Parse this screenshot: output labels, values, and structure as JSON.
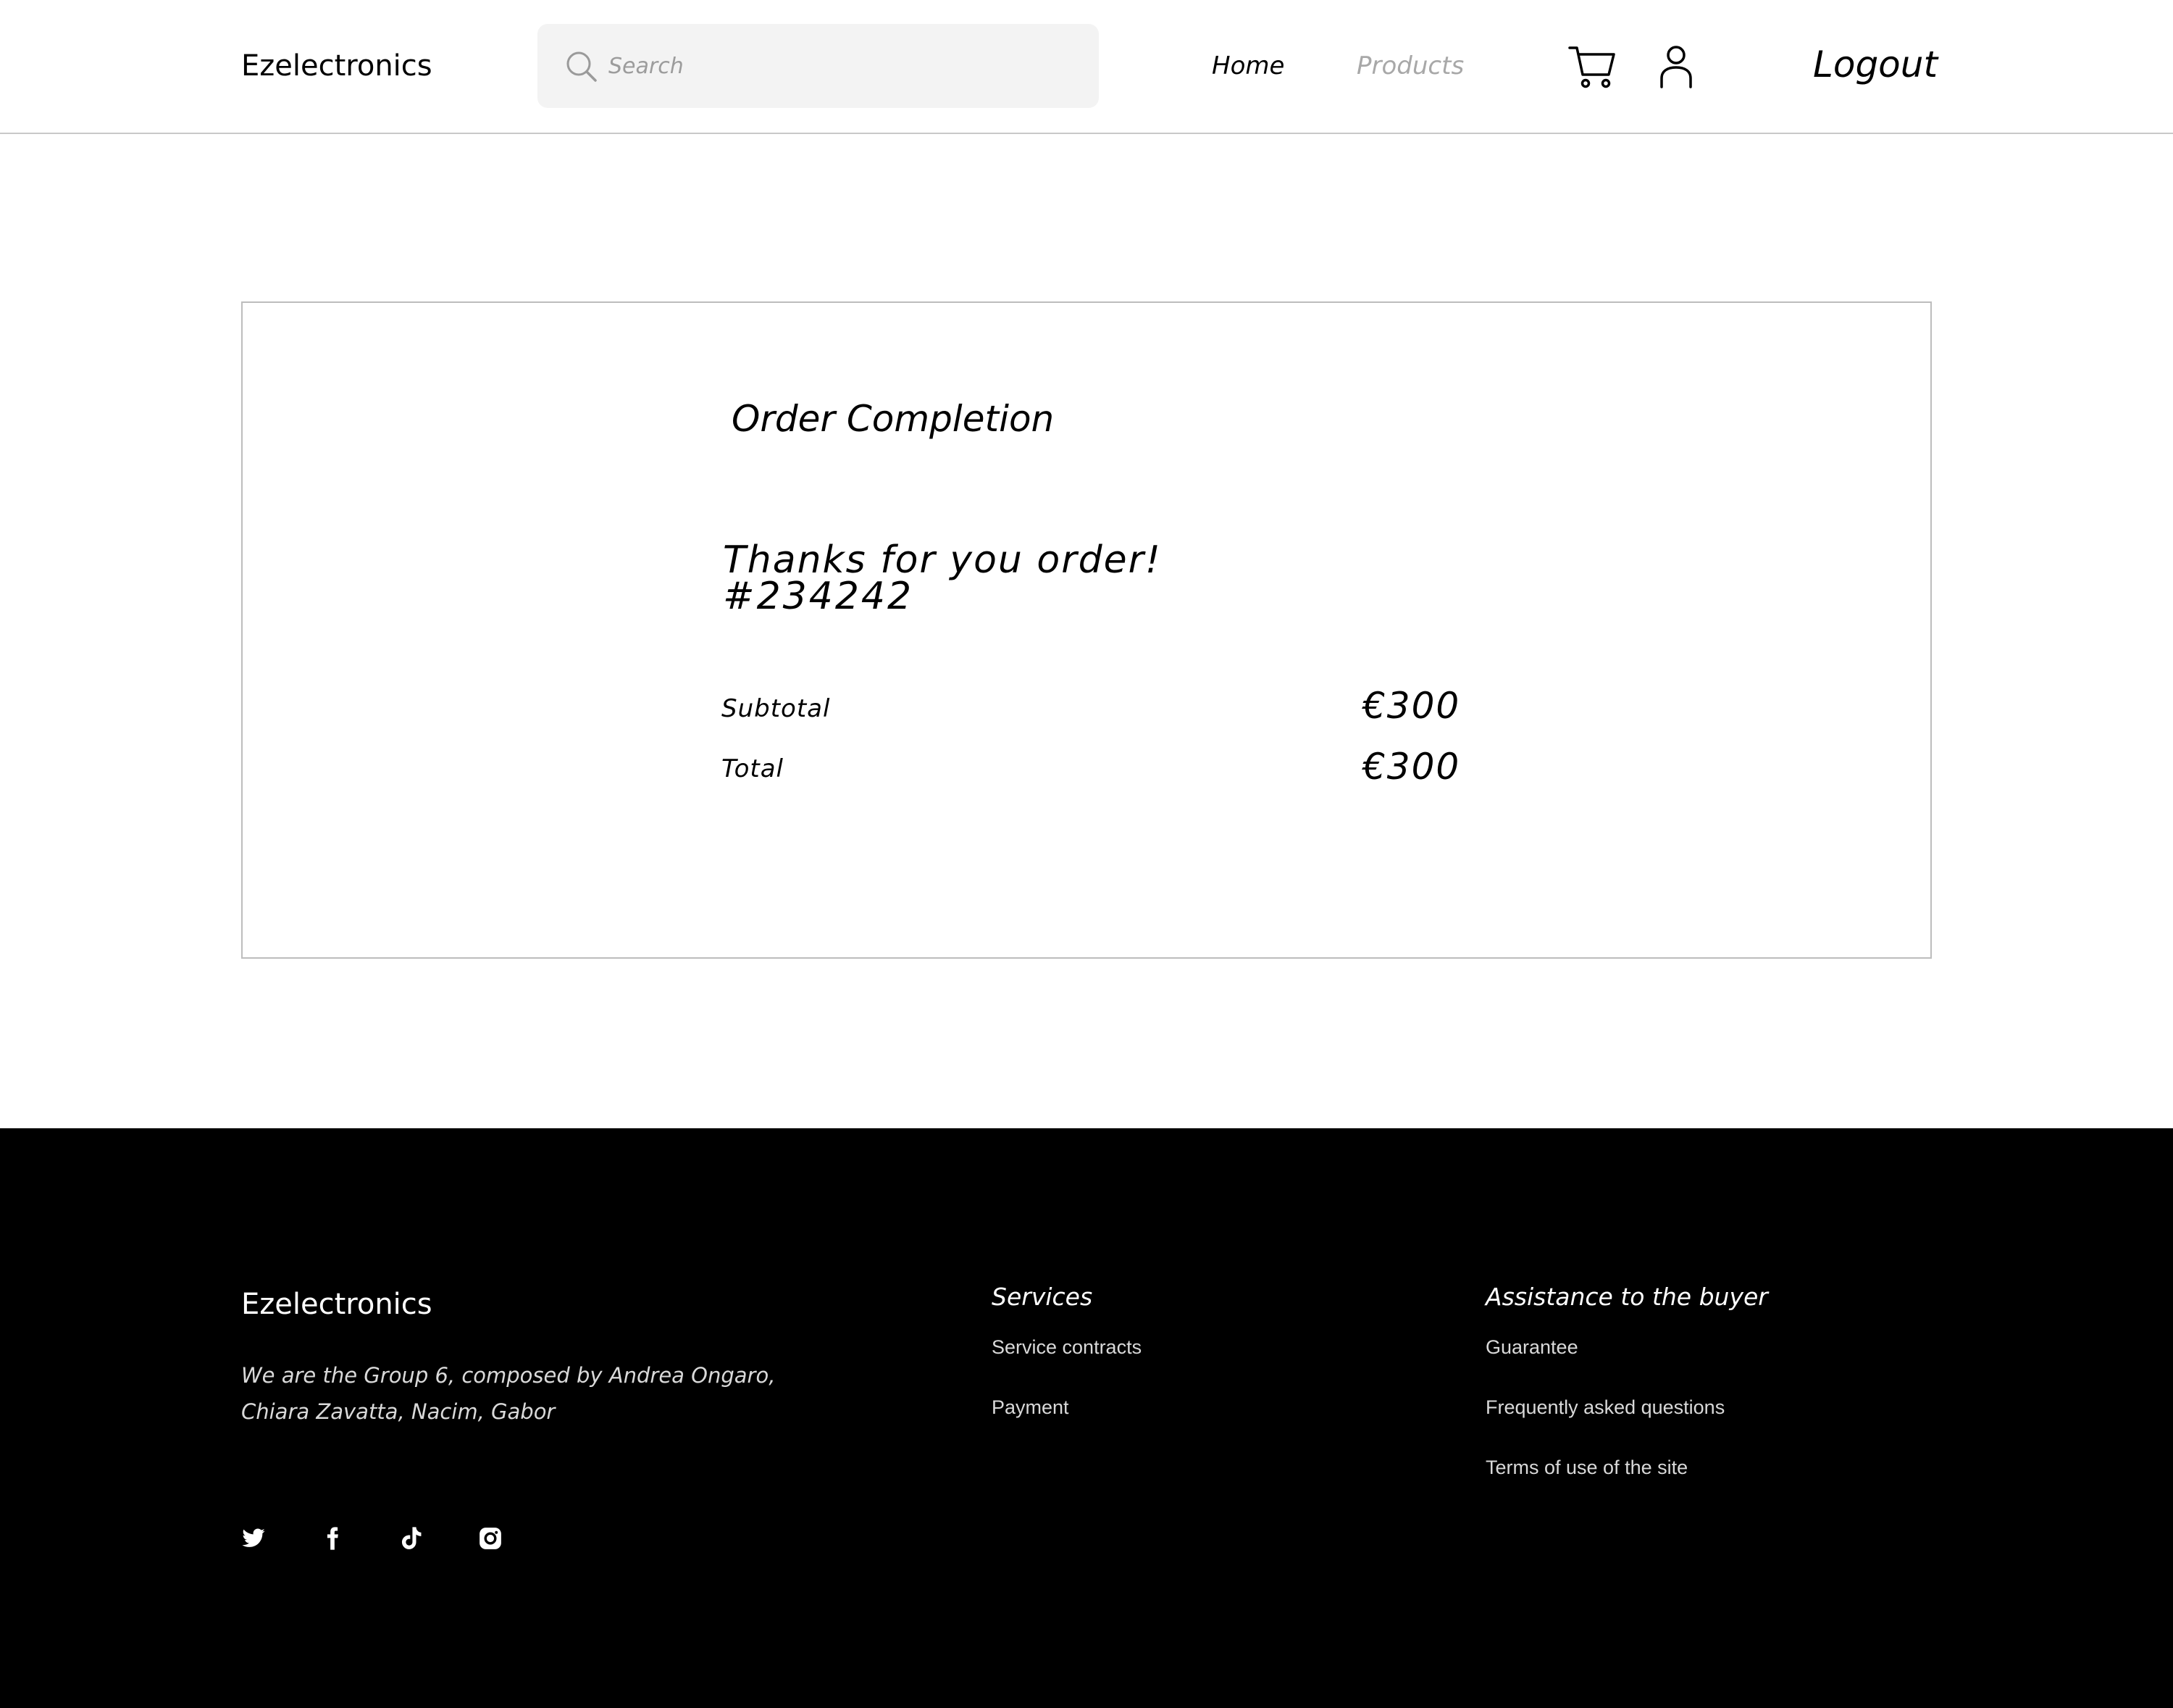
{
  "header": {
    "brand": "Ezelectronics",
    "search": {
      "placeholder": "Search",
      "value": ""
    },
    "nav": {
      "home": "Home",
      "products": "Products"
    },
    "logout": "Logout",
    "icons": {
      "search": "search-icon",
      "cart": "cart-icon",
      "user": "user-icon"
    }
  },
  "order": {
    "title": "Order Completion",
    "thanks": "Thanks for you order!",
    "order_number": "#234242",
    "subtotal_label": "Subtotal",
    "subtotal_value": "€300",
    "total_label": "Total",
    "total_value": "€300"
  },
  "footer": {
    "brand": "Ezelectronics",
    "about": "We are the Group 6, composed by Andrea Ongaro, Chiara Zavatta, Nacim, Gabor",
    "socials": [
      "twitter-icon",
      "facebook-icon",
      "tiktok-icon",
      "instagram-icon"
    ],
    "services": {
      "heading": "Services",
      "links": [
        "Service contracts",
        "Payment"
      ]
    },
    "assistance": {
      "heading": "Assistance to the buyer",
      "links": [
        "Guarantee",
        "Frequently asked questions",
        "Terms of use of the site"
      ]
    }
  },
  "colors": {
    "background": "#ffffff",
    "footer_bg": "#000000",
    "search_bg": "#f3f3f3",
    "muted_nav": "#a8a8a8",
    "border": "#bdbdbd"
  }
}
